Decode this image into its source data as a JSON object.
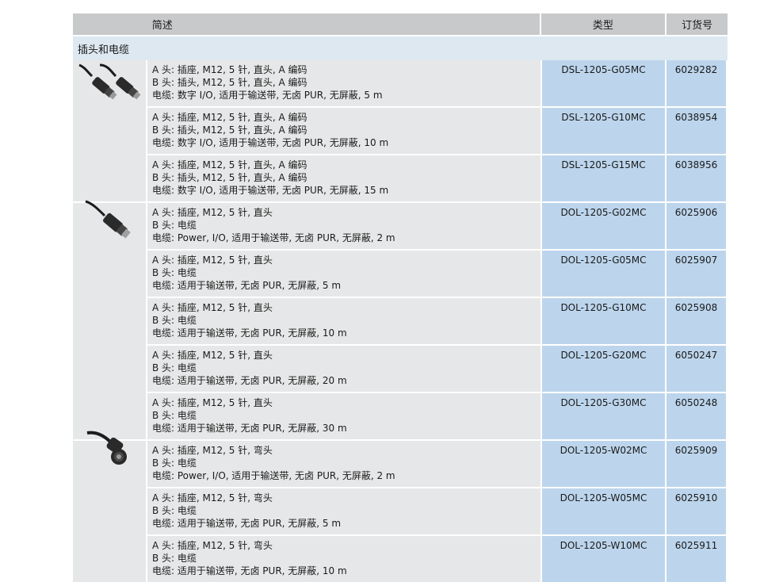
{
  "header": {
    "desc_label": "简述",
    "type_label": "类型",
    "order_label": "订货号"
  },
  "section_title": "插头和电缆",
  "product_images": [
    {
      "icon": "double-m12-straight-cable-icon"
    },
    {
      "icon": "single-m12-straight-cable-icon"
    },
    {
      "icon": "single-m12-angled-cable-icon"
    }
  ],
  "rows": [
    {
      "line1": "A 头: 插座, M12, 5 针, 直头, A 编码",
      "line2": "B 头: 插头, M12, 5 针, 直头, A 编码",
      "line3": "电缆: 数字 I/O, 适用于输送带, 无卤 PUR, 无屏蔽, 5 m",
      "type": "DSL-1205-G05MC",
      "order": "6029282"
    },
    {
      "line1": "A 头: 插座, M12, 5 针, 直头, A 编码",
      "line2": "B 头: 插头, M12, 5 针, 直头, A 编码",
      "line3": "电缆: 数字 I/O, 适用于输送带, 无卤 PUR, 无屏蔽, 10 m",
      "type": "DSL-1205-G10MC",
      "order": "6038954"
    },
    {
      "line1": "A 头: 插座, M12, 5 针, 直头, A 编码",
      "line2": "B 头: 插头, M12, 5 针, 直头, A 编码",
      "line3": "电缆: 数字 I/O, 适用于输送带, 无卤 PUR, 无屏蔽, 15 m",
      "type": "DSL-1205-G15MC",
      "order": "6038956"
    },
    {
      "line1": "A 头: 插座, M12, 5 针, 直头",
      "line2": "B 头: 电缆",
      "line3": "电缆: Power, I/O, 适用于输送带, 无卤 PUR, 无屏蔽, 2 m",
      "type": "DOL-1205-G02MC",
      "order": "6025906"
    },
    {
      "line1": "A 头: 插座, M12, 5 针, 直头",
      "line2": "B 头: 电缆",
      "line3": "电缆: 适用于输送带, 无卤 PUR, 无屏蔽, 5 m",
      "type": "DOL-1205-G05MC",
      "order": "6025907"
    },
    {
      "line1": "A 头: 插座, M12, 5 针, 直头",
      "line2": "B 头: 电缆",
      "line3": "电缆: 适用于输送带, 无卤 PUR, 无屏蔽, 10 m",
      "type": "DOL-1205-G10MC",
      "order": "6025908"
    },
    {
      "line1": "A 头: 插座, M12, 5 针, 直头",
      "line2": "B 头: 电缆",
      "line3": "电缆: 适用于输送带, 无卤 PUR, 无屏蔽, 20 m",
      "type": "DOL-1205-G20MC",
      "order": "6050247"
    },
    {
      "line1": "A 头: 插座, M12, 5 针, 直头",
      "line2": "B 头: 电缆",
      "line3": "电缆: 适用于输送带, 无卤 PUR, 无屏蔽, 30 m",
      "type": "DOL-1205-G30MC",
      "order": "6050248"
    },
    {
      "line1": "A 头: 插座, M12, 5 针, 弯头",
      "line2": "B 头: 电缆",
      "line3": "电缆: Power, I/O, 适用于输送带, 无卤 PUR, 无屏蔽, 2 m",
      "type": "DOL-1205-W02MC",
      "order": "6025909"
    },
    {
      "line1": "A 头: 插座, M12, 5 针, 弯头",
      "line2": "B 头: 电缆",
      "line3": "电缆: 适用于输送带, 无卤 PUR, 无屏蔽, 5 m",
      "type": "DOL-1205-W05MC",
      "order": "6025910"
    },
    {
      "line1": "A 头: 插座, M12, 5 针, 弯头",
      "line2": "B 头: 电缆",
      "line3": "电缆: 适用于输送带, 无卤 PUR, 无屏蔽, 10 m",
      "type": "DOL-1205-W10MC",
      "order": "6025911"
    }
  ]
}
